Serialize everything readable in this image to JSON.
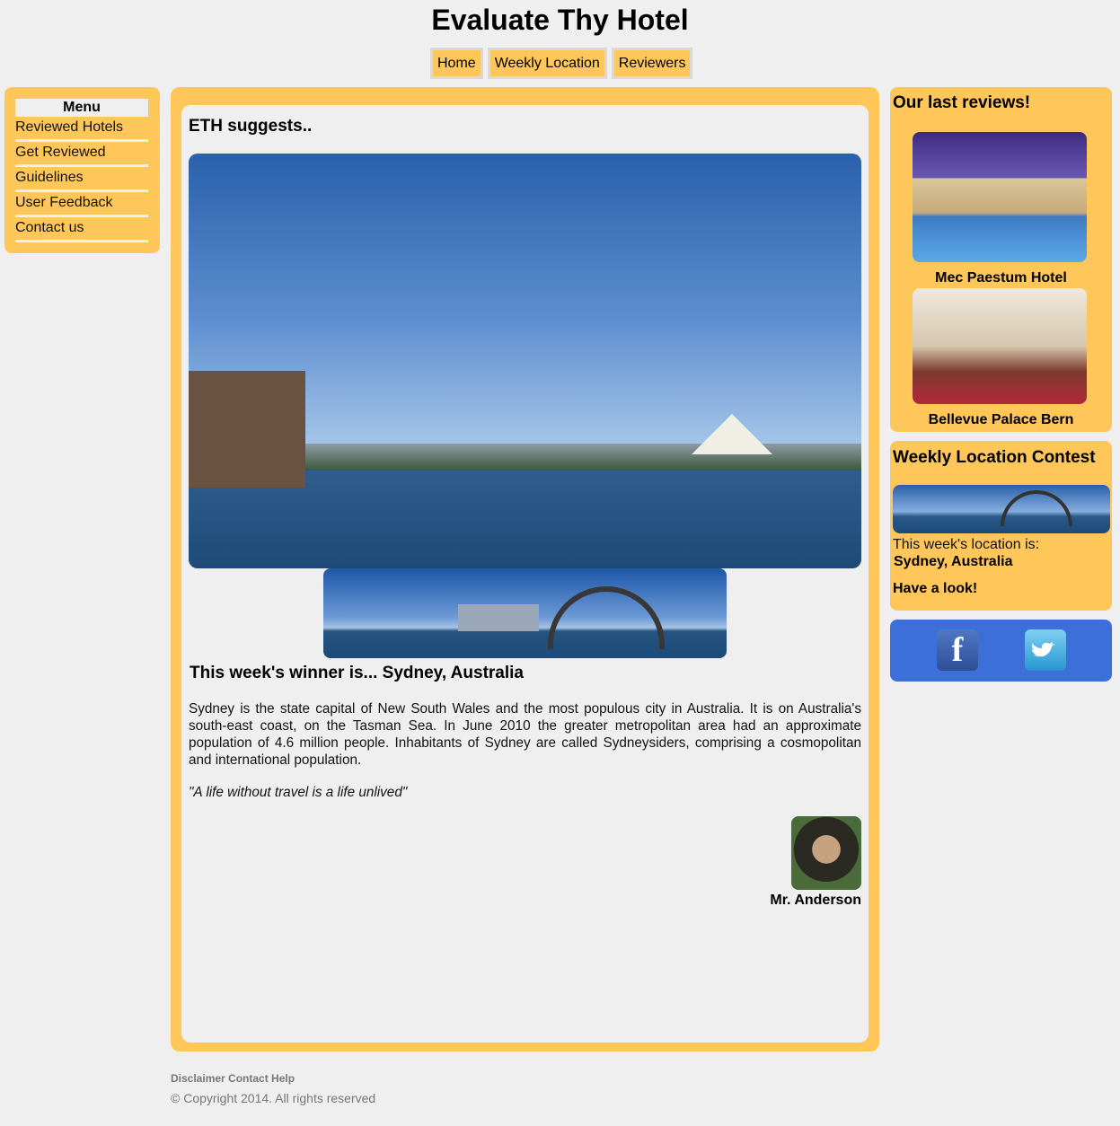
{
  "site": {
    "title": "Evaluate Thy Hotel"
  },
  "topnav": {
    "items": [
      "Home",
      "Weekly Location",
      "Reviewers"
    ]
  },
  "menu": {
    "title": "Menu",
    "items": [
      "Reviewed Hotels",
      "Get Reviewed",
      "Guidelines",
      "User Feedback",
      "Contact us"
    ]
  },
  "main": {
    "suggest_title": "ETH suggests..",
    "winner_title": "This week's winner is... Sydney, Australia",
    "description": "Sydney is the state capital of New South Wales and the most populous city in Australia. It is on Australia's south-east coast, on the Tasman Sea. In June 2010 the greater metropolitan area had an approximate population of 4.6 million people. Inhabitants of Sydney are called Sydneysiders, comprising a cosmopolitan and international population.",
    "quote": "\"A life without travel is a life unlived\"",
    "author": "Mr. Anderson"
  },
  "reviews": {
    "title": "Our last reviews!",
    "hotels": [
      "Mec Paestum Hotel",
      "Bellevue Palace Bern"
    ]
  },
  "contest": {
    "title": "Weekly Location Contest",
    "text": "This week's location is:",
    "location": "Sydney, Australia",
    "link": "Have a look!"
  },
  "social": {
    "facebook_glyph": "f",
    "twitter_glyph": "t"
  },
  "footer": {
    "links": "Disclaimer Contact Help",
    "copyright": "© Copyright 2014. All rights reserved"
  }
}
